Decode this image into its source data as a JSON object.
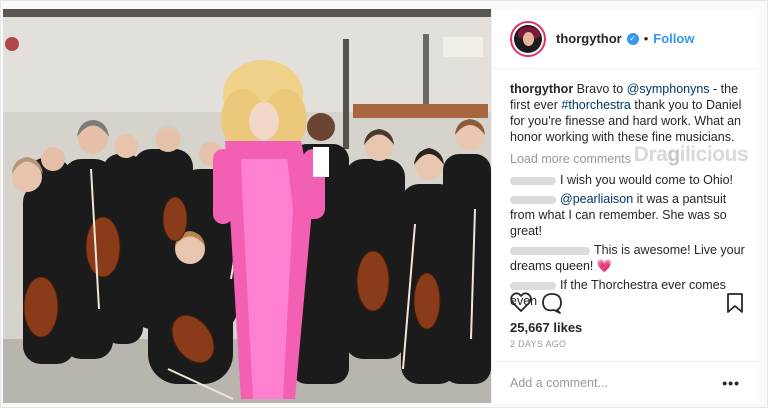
{
  "post": {
    "username": "thorgythor",
    "follow_label": "Follow",
    "separator": "•",
    "caption": {
      "username": "thorgythor",
      "text_1": " Bravo to ",
      "mention": "@symphonyns",
      "text_2": " - the first ever ",
      "hashtag": "#thorchestra",
      "text_3": " thank you to Daniel for you're finesse and hard work. What an honor working with these fine musicians."
    },
    "load_more_label": "Load more comments",
    "watermark": "Dragilicious",
    "comments": [
      {
        "text": "I wish you would come to Ohio!"
      },
      {
        "mention": "@pearliaison",
        "text": " it was a pantsuit from what I can remember. She was so great!"
      },
      {
        "text": "This is awesome! Live your dreams queen! "
      },
      {
        "text": "If the Thorchestra ever comes even"
      }
    ],
    "heart_emoji": "💗",
    "likes": "25,667 likes",
    "time_ago": "2 DAYS AGO",
    "add_comment_placeholder": "Add a comment...",
    "more_label": "•••"
  },
  "colors": {
    "link": "#3897f0",
    "mention": "#003569",
    "story_ring": "#e1306c"
  }
}
